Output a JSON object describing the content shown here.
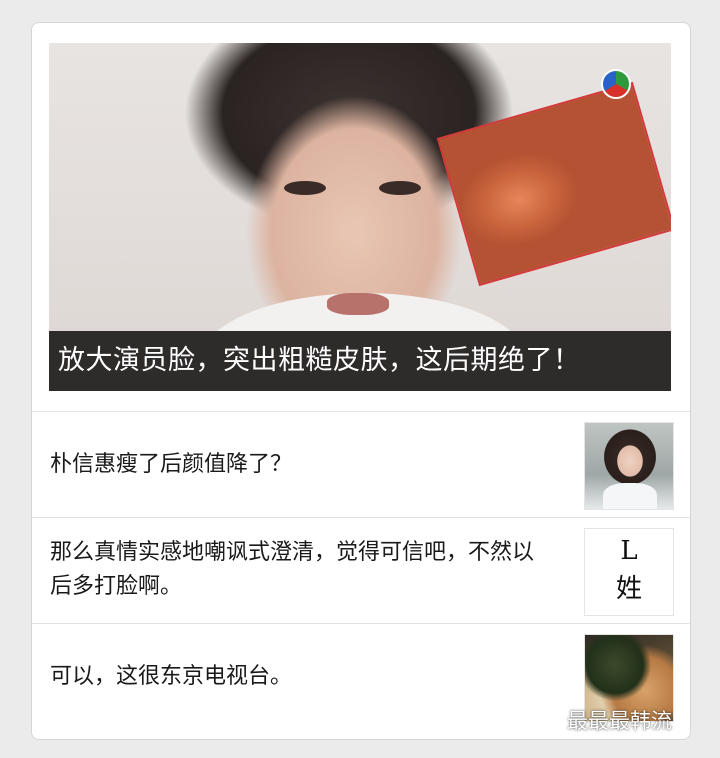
{
  "hero": {
    "caption": "放大演员脸，突出粗糙皮肤，这后期绝了！"
  },
  "items": [
    {
      "text": "朴信惠瘦了后颜值降了？",
      "thumb": "person-photo"
    },
    {
      "text": "那么真情实感地嘲讽式澄清，觉得可信吧，不然以后多打脸啊。",
      "thumb_line1": "L",
      "thumb_line2": "姓"
    },
    {
      "text": "可以，这很东京电视台。",
      "thumb": "food-photo"
    }
  ],
  "watermark": {
    "icon": "wechat-icon",
    "label": "最最最韩流"
  }
}
